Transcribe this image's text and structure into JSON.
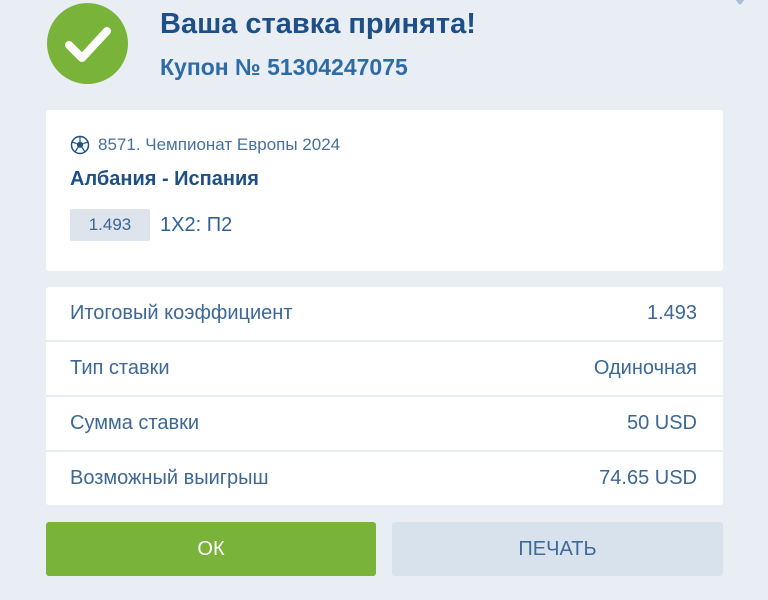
{
  "header": {
    "title": "Ваша ставка принята!",
    "coupon": "Купон № 51304247075",
    "success_icon": "checkmark-icon"
  },
  "event": {
    "sport_icon": "soccer-ball-icon",
    "league": "8571. Чемпионат Европы 2024",
    "match": "Албания - Испания",
    "odds": "1.493",
    "outcome": "1Х2: П2"
  },
  "summary": {
    "rows": [
      {
        "label": "Итоговый коэффициент",
        "value": "1.493"
      },
      {
        "label": "Тип ставки",
        "value": "Одиночная"
      },
      {
        "label": "Сумма ставки",
        "value": "50 USD"
      },
      {
        "label": "Возможный выигрыш",
        "value": "74.65 USD"
      }
    ]
  },
  "buttons": {
    "ok": "ОК",
    "print": "ПЕЧАТЬ"
  },
  "colors": {
    "success_green": "#79b33a",
    "title_blue": "#1e4f86",
    "background": "#e9eef4"
  }
}
